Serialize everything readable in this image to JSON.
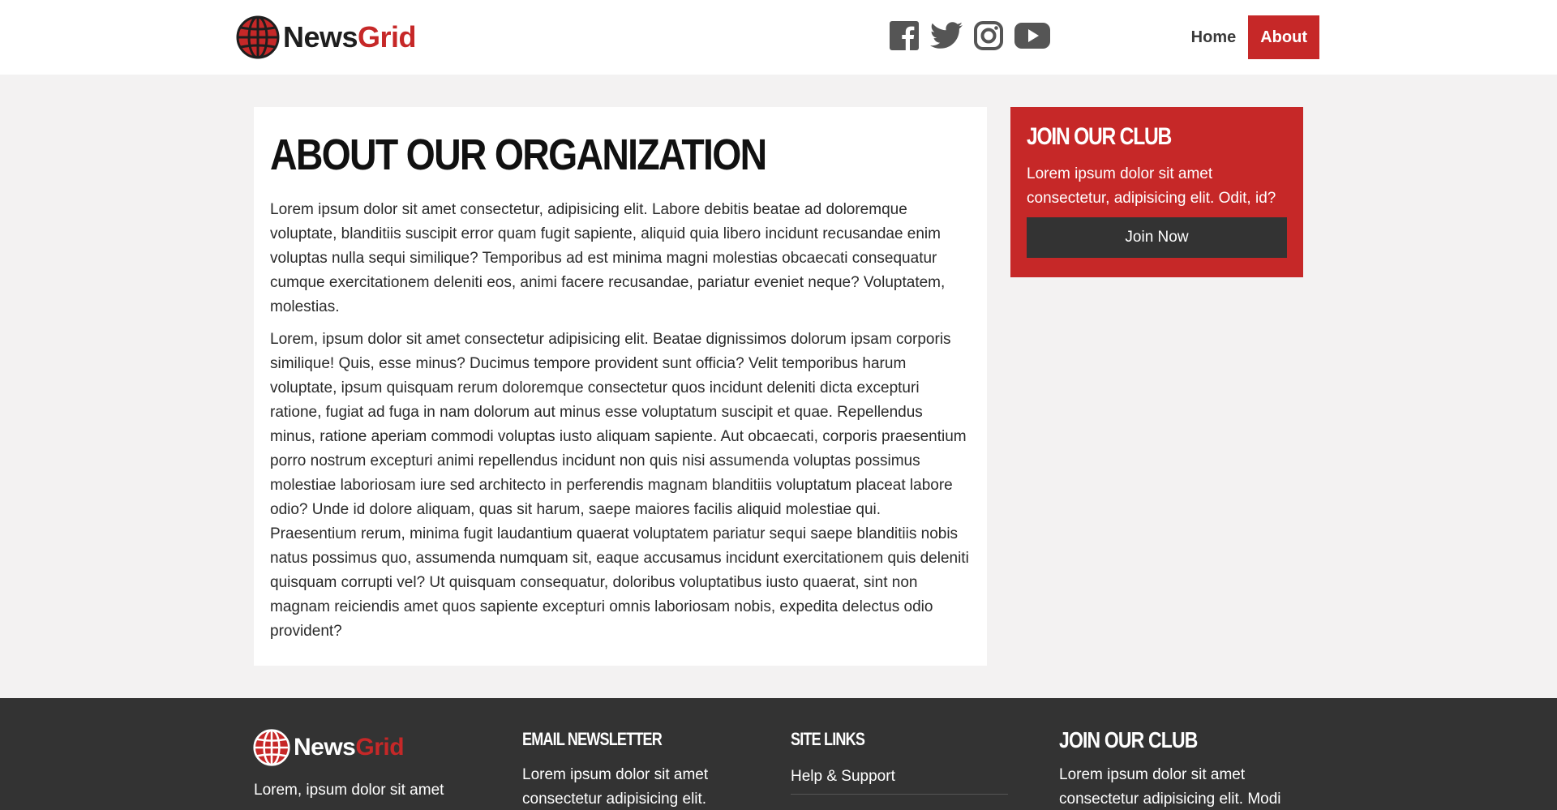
{
  "header": {
    "logo": {
      "word1": "News",
      "word2": "Grid"
    },
    "social": [
      {
        "icon": "facebook-icon"
      },
      {
        "icon": "twitter-icon"
      },
      {
        "icon": "instagram-icon"
      },
      {
        "icon": "youtube-icon"
      }
    ],
    "nav": [
      {
        "label": "Home",
        "active": false
      },
      {
        "label": "About",
        "active": true
      }
    ]
  },
  "main": {
    "title": "About Our Organization",
    "paragraphs": [
      "Lorem ipsum dolor sit amet consectetur, adipisicing elit. Labore debitis beatae ad doloremque voluptate, blanditiis suscipit error quam fugit sapiente, aliquid quia libero incidunt recusandae enim voluptas nulla sequi similique? Temporibus ad est minima magni molestias obcaecati consequatur cumque exercitationem deleniti eos, animi facere recusandae, pariatur eveniet neque? Voluptatem, molestias.",
      "Lorem, ipsum dolor sit amet consectetur adipisicing elit. Beatae dignissimos dolorum ipsam corporis similique! Quis, esse minus? Ducimus tempore provident sunt officia? Velit temporibus harum voluptate, ipsum quisquam rerum doloremque consectetur quos incidunt deleniti dicta excepturi ratione, fugiat ad fuga in nam dolorum aut minus esse voluptatum suscipit et quae. Repellendus minus, ratione aperiam commodi voluptas iusto aliquam sapiente. Aut obcaecati, corporis praesentium porro nostrum excepturi animi repellendus incidunt non quis nisi assumenda voluptas possimus molestiae laboriosam iure sed architecto in perferendis magnam blanditiis voluptatum placeat labore odio? Unde id dolore aliquam, quas sit harum, saepe maiores facilis aliquid molestiae qui. Praesentium rerum, minima fugit laudantium quaerat voluptatem pariatur sequi saepe blanditiis nobis natus possimus quo, assumenda numquam sit, eaque accusamus incidunt exercitationem quis deleniti quisquam corrupti vel? Ut quisquam consequatur, doloribus voluptatibus iusto quaerat, sint non magnam reiciendis amet quos sapiente excepturi omnis laboriosam nobis, expedita delectus odio provident?"
    ]
  },
  "sidebar": {
    "club": {
      "title": "Join Our Club",
      "text": "Lorem ipsum dolor sit amet consectetur, adipisicing elit. Odit, id?",
      "button": "Join Now"
    }
  },
  "footer": {
    "logo": {
      "word1": "News",
      "word2": "Grid"
    },
    "about_text": "Lorem, ipsum dolor sit amet",
    "newsletter": {
      "title": "Email Newsletter",
      "text_line1": "Lorem ipsum dolor sit amet",
      "text_line2": "consectetur adipisicing elit."
    },
    "site_links": {
      "title": "Site Links",
      "links": [
        "Help & Support"
      ]
    },
    "club": {
      "title": "Join Our Club",
      "text_line1": "Lorem ipsum dolor sit amet",
      "text_line2": "consectetur adipisicing elit. Modi"
    }
  },
  "colors": {
    "brand_red": "#c62828",
    "dark": "#333333",
    "background": "#f3f2f2"
  }
}
